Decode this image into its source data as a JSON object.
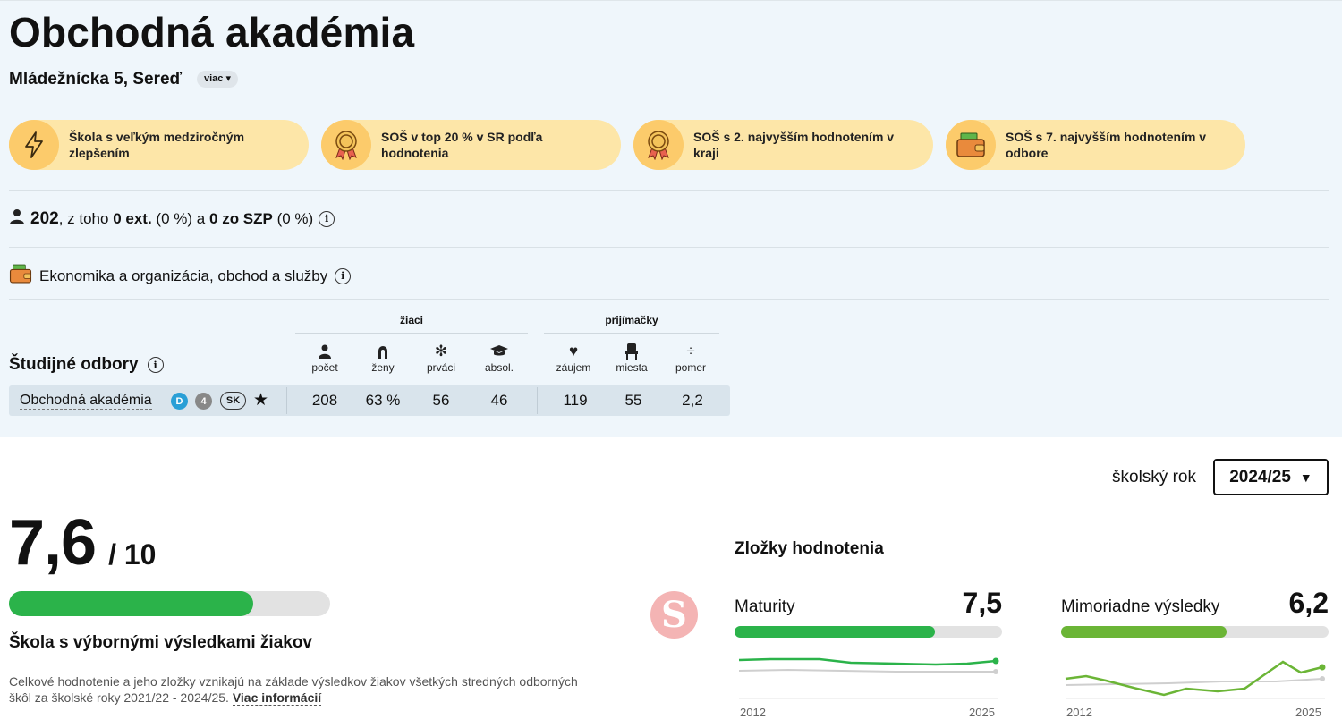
{
  "school": {
    "name": "Obchodná akadémia",
    "address": "Mládežnícka 5, Sereď",
    "more_label": "viac ▾"
  },
  "badges": [
    {
      "icon": "lightning-icon",
      "text": "Škola s veľkým medziročným zlepšením"
    },
    {
      "icon": "medal-icon",
      "text": "SOŠ v top 20 % v SR podľa hodnotenia"
    },
    {
      "icon": "medal-icon",
      "text": "SOŠ s 2. najvyšším hodnotením v kraji"
    },
    {
      "icon": "wallet-icon",
      "text": "SOŠ s 7. najvyšším hodnotením v odbore"
    }
  ],
  "students": {
    "total": "202",
    "t1": ", z toho ",
    "ext_count": "0",
    "ext_label": "ext.",
    "ext_pct": "(0 %)",
    "t2": "a",
    "szp_count": "0",
    "szp_label": "zo SZP",
    "szp_pct": "(0 %)"
  },
  "field": {
    "label": "Ekonomika a organizácia, obchod a služby"
  },
  "programs": {
    "section_title": "Študijné odbory",
    "group_students": "žiaci",
    "group_admissions": "prijímačky",
    "columns": [
      "počet",
      "ženy",
      "prváci",
      "absol.",
      "záujem",
      "miesta",
      "pomer"
    ],
    "rows": [
      {
        "name": "Obchodná akadémia",
        "tag_d": "D",
        "tag_years": "4",
        "tag_lang": "SK",
        "values": [
          "208",
          "63 %",
          "56",
          "46",
          "119",
          "55",
          "2,2"
        ]
      }
    ]
  },
  "year": {
    "label": "školský rok",
    "selected": "2024/25"
  },
  "rating": {
    "score": "7,6",
    "max": "/ 10",
    "fraction": 0.76,
    "verdict": "Škola s výbornými výsledkami žiakov",
    "note": "Celkové hodnotenie a jeho zložky vznikajú na základe výsledkov žiakov všetkých stredných odborných škôl za školské roky 2021/22 - 2024/25.",
    "more_link": "Viac informácií"
  },
  "components": {
    "title": "Zložky hodnotenia",
    "items": [
      {
        "name": "Maturity",
        "value": "7,5",
        "fraction": 0.75,
        "color": "#2bb34a",
        "year_start": "2012",
        "year_end": "2025"
      },
      {
        "name": "Mimoriadne výsledky",
        "value": "6,2",
        "fraction": 0.62,
        "color": "#6bb536",
        "year_start": "2012",
        "year_end": "2025"
      }
    ]
  },
  "colors": {
    "background_top": "#eff6fb",
    "badge": "#fde6a8",
    "badge_icon": "#fccb6b",
    "rating_bar": "#2bb34a",
    "tag_d": "#2a9fd6",
    "tag_years": "#888888"
  }
}
